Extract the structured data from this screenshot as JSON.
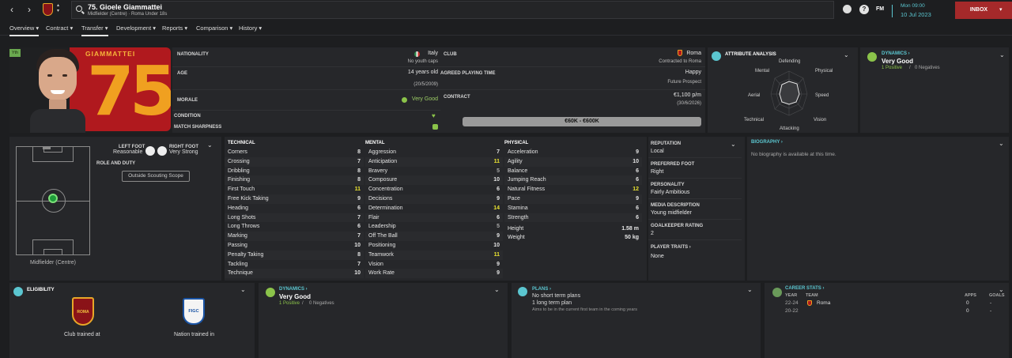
{
  "header": {
    "title": "75. Gioele Giammattei",
    "subtitle": "Midfielder (Centre) · Roma Under 18s",
    "fm_label": "FM",
    "date_day": "Mon 09:00",
    "date": "10 Jul 2023",
    "inbox_label": "INBOX"
  },
  "tabs": [
    {
      "label": "Overview"
    },
    {
      "label": "Contract"
    },
    {
      "label": "Transfer"
    },
    {
      "label": "Development"
    },
    {
      "label": "Reports"
    },
    {
      "label": "Comparison"
    },
    {
      "label": "History"
    }
  ],
  "profile": {
    "yth_badge": "Yth",
    "surname": "GIAMMATTEI",
    "number": "75",
    "nationality_label": "NATIONALITY",
    "nationality": "Italy",
    "nationality_sub": "No youth caps",
    "age_label": "AGE",
    "age": "14 years old",
    "dob": "(20/5/2009)",
    "morale_label": "MORALE",
    "morale": "Very Good",
    "condition_label": "CONDITION",
    "sharpness_label": "MATCH SHARPNESS",
    "club_label": "CLUB",
    "club": "Roma",
    "club_sub": "Contracted to Roma",
    "apt_label": "AGREED PLAYING TIME",
    "apt": "Happy",
    "apt_sub": "Future Prospect",
    "contract_label": "CONTRACT",
    "contract_wage": "€1,100 p/m",
    "contract_end": "(30/6/2026)",
    "value_range": "€60K - €600K"
  },
  "attr_analysis": {
    "title": "ATTRIBUTE ANALYSIS",
    "labels": [
      "Defending",
      "Physical",
      "Speed",
      "Vision",
      "Attacking",
      "Technical",
      "Aerial",
      "Mental"
    ]
  },
  "dynamics_top": {
    "title": "DYNAMICS",
    "value": "Very Good",
    "positives": "1 Positive",
    "sep": "/",
    "negatives": "0 Negatives"
  },
  "pitch": {
    "left_foot_label": "LEFT FOOT",
    "left_foot": "Reasonable",
    "right_foot_label": "RIGHT FOOT",
    "right_foot": "Very Strong",
    "role_label": "ROLE AND DUTY",
    "scope_button": "Outside Scouting Scope",
    "position": "Midfielder (Centre)"
  },
  "technical": {
    "title": "TECHNICAL",
    "rows": [
      [
        "Corners",
        "8"
      ],
      [
        "Crossing",
        "7"
      ],
      [
        "Dribbling",
        "8"
      ],
      [
        "Finishing",
        "8"
      ],
      [
        "First Touch",
        "11"
      ],
      [
        "Free Kick Taking",
        "9"
      ],
      [
        "Heading",
        "6"
      ],
      [
        "Long Shots",
        "7"
      ],
      [
        "Long Throws",
        "6"
      ],
      [
        "Marking",
        "7"
      ],
      [
        "Passing",
        "10"
      ],
      [
        "Penalty Taking",
        "8"
      ],
      [
        "Tackling",
        "7"
      ],
      [
        "Technique",
        "10"
      ]
    ]
  },
  "mental": {
    "title": "MENTAL",
    "rows": [
      [
        "Aggression",
        "7"
      ],
      [
        "Anticipation",
        "11"
      ],
      [
        "Bravery",
        "5"
      ],
      [
        "Composure",
        "10"
      ],
      [
        "Concentration",
        "6"
      ],
      [
        "Decisions",
        "9"
      ],
      [
        "Determination",
        "14"
      ],
      [
        "Flair",
        "6"
      ],
      [
        "Leadership",
        "5"
      ],
      [
        "Off The Ball",
        "9"
      ],
      [
        "Positioning",
        "10"
      ],
      [
        "Teamwork",
        "11"
      ],
      [
        "Vision",
        "9"
      ],
      [
        "Work Rate",
        "9"
      ]
    ]
  },
  "physical": {
    "title": "PHYSICAL",
    "rows": [
      [
        "Acceleration",
        "9"
      ],
      [
        "Agility",
        "10"
      ],
      [
        "Balance",
        "6"
      ],
      [
        "Jumping Reach",
        "6"
      ],
      [
        "Natural Fitness",
        "12"
      ],
      [
        "Pace",
        "9"
      ],
      [
        "Stamina",
        "6"
      ],
      [
        "Strength",
        "6"
      ]
    ],
    "height_label": "Height",
    "height": "1.58 m",
    "weight_label": "Weight",
    "weight": "50 kg"
  },
  "info": {
    "reputation_label": "REPUTATION",
    "reputation": "Local",
    "foot_label": "PREFERRED FOOT",
    "foot": "Right",
    "personality_label": "PERSONALITY",
    "personality": "Fairly Ambitious",
    "media_label": "MEDIA DESCRIPTION",
    "media": "Young midfielder",
    "gk_label": "GOALKEEPER RATING",
    "gk": "2",
    "traits_label": "PLAYER TRAITS",
    "traits": "None"
  },
  "biography": {
    "title": "BIOGRAPHY",
    "text": "No biography is available at this time."
  },
  "eligibility": {
    "title": "ELIGIBILITY",
    "club_label": "Club trained at",
    "nation_label": "Nation trained in",
    "club_badge": "ROMA",
    "nation_badge": "FIGC"
  },
  "dynamics_bottom": {
    "title": "DYNAMICS",
    "value": "Very Good",
    "positives": "1 Positive",
    "sep": "/",
    "negatives": "0 Negatives"
  },
  "plans": {
    "title": "PLANS",
    "line1": "No short term plans",
    "line2": "1 long term plan",
    "line3": "Aims to be in the current first team in the coming years"
  },
  "career": {
    "title": "CAREER STATS",
    "col_year": "YEAR",
    "col_team": "TEAM",
    "col_apps": "APPS",
    "col_goals": "GOALS",
    "rows": [
      {
        "year": "22-24",
        "team": "Roma",
        "apps": "0",
        "goals": "-"
      },
      {
        "year": "20-22",
        "team": "",
        "apps": "0",
        "goals": "-"
      }
    ]
  },
  "colors": {
    "accent_green": "#8bc34a",
    "accent_teal": "#5bc6d0",
    "highlight_yellow": "#e8e130",
    "roma_red": "#b0191e",
    "roma_gold": "#f0a020",
    "inbox_red": "#a5292a"
  }
}
